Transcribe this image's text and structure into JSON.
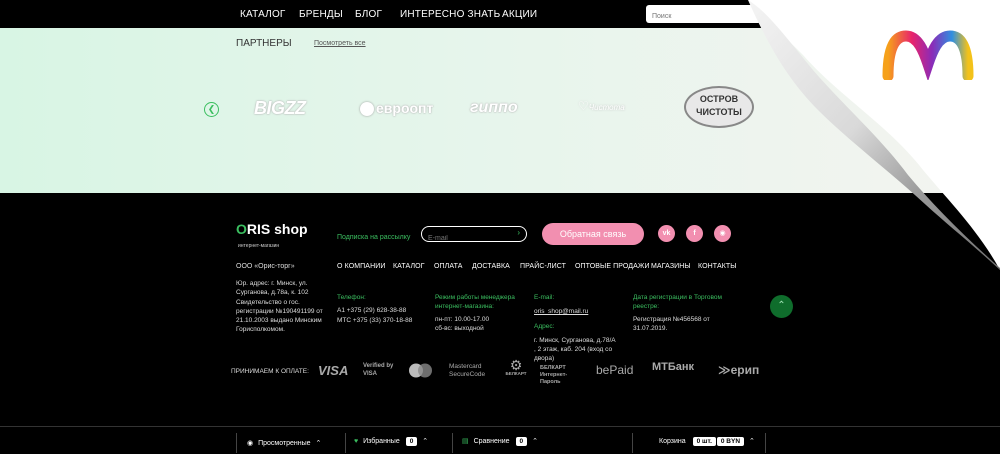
{
  "topnav": {
    "items": [
      "КАТАЛОГ",
      "БРЕНДЫ",
      "БЛОГ",
      "ИНТЕРЕСНО ЗНАТЬ",
      "АКЦИИ"
    ],
    "search_placeholder": "Поиск"
  },
  "partners": {
    "title": "ПАРТНЕРЫ",
    "see_all": "Посмотреть все",
    "logos": [
      "BIGZZ",
      "евроопт",
      "гиппо",
      "Чистота",
      "ОСТРОВ ЧИСТОТЫ"
    ]
  },
  "footer": {
    "brand": "ORIS shop",
    "brand_sub": "интернет-магазин",
    "subscribe_label": "Подписка на рассылку",
    "email_placeholder": "E-mail",
    "feedback_button": "Обратная связь",
    "company": "ООО «Орис-торг»",
    "nav": [
      "О КОМПАНИИ",
      "КАТАЛОГ",
      "ОПЛАТА",
      "ДОСТАВКА",
      "ПРАЙС-ЛИСТ",
      "ОПТОВЫЕ ПРОДАЖИ",
      "МАГАЗИНЫ",
      "КОНТАКТЫ"
    ],
    "legal_address": "Юр. адрес: г. Минск, ул. Сурганова, д.78а, к. 102",
    "certificate": "Свидетельство о гос. регистрации №190491199 от 21.10.2003 выдано Минским Горисполкомом.",
    "phones_label": "Телефон:",
    "phone_a1": "А1 +375 (29) 628-38-88",
    "phone_mts": "МТС +375 (33) 370-18-88",
    "hours_label": "Режим работы менеджера интернет-магазина:",
    "hours_weekdays": "пн-пт: 10.00-17.00",
    "hours_weekend": "сб-вс: выходной",
    "email_label": "E-mail:",
    "email_value": "oris_shop@mail.ru",
    "address_label": "Адрес:",
    "address_value": "г. Минск, Сурганова, д.78/А , 2 этаж, каб. 204 (вход со двора)",
    "reg_label": "Дата регистрации в Торговом реестре:",
    "reg_value": "Регистрация №456568 от 31.07.2019.",
    "payment_label": "ПРИНИМАЕМ К ОПЛАТЕ:",
    "payments": [
      "VISA",
      "Verified by VISA",
      "Mastercard SecureCode",
      "БЕЛКАРТ",
      "БЕЛКАРТ Интернет-Пароль",
      "bePaid",
      "МТБанк",
      "ерип"
    ],
    "social_icons": [
      "vk-icon",
      "facebook-icon",
      "instagram-icon"
    ]
  },
  "bottombar": {
    "viewed": "Просмотренные",
    "favorites": "Избранные",
    "favorites_count": "0",
    "compare": "Сравнение",
    "compare_count": "0",
    "cart": "Корзина",
    "cart_items": "0 шт.",
    "cart_sum": "0 BYN"
  },
  "colors": {
    "accent_green": "#3bbf60",
    "accent_pink": "#f28fb0",
    "partners_bg": "#e7f5ec"
  }
}
